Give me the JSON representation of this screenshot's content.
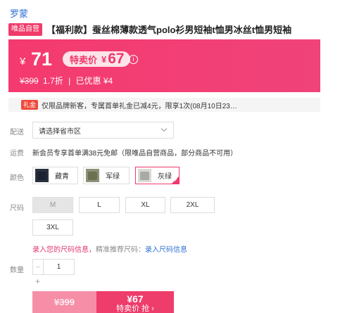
{
  "brand": "罗蒙",
  "product": {
    "vip_tag": "唯品自营",
    "title": "【福利款】蚕丝棉薄款透气polo衫男短袖t恤男冰丝t恤男短袖"
  },
  "price": {
    "yen": "¥",
    "current": "71",
    "special_label": "特卖价",
    "special_yen": "¥",
    "special_value": "67",
    "info_icon": "i",
    "original": "¥399",
    "discount": "1.7折",
    "separator": "|",
    "saved": "已优惠 ¥4"
  },
  "coupon": {
    "badge": "礼金",
    "text": "仅限品牌新客，专属首单礼金已减4元，限享1次(08月10日23…"
  },
  "delivery": {
    "label": "配送",
    "select_placeholder": "请选择省市区"
  },
  "freight": {
    "label": "运费",
    "text": "新会员专享首单满38元免邮（限唯品自营商品，部分商品不可用）"
  },
  "colors": {
    "label": "颜色",
    "options": [
      {
        "name": "藏青",
        "icon": "navy-shirt-thumbnail",
        "selected": false
      },
      {
        "name": "军绿",
        "icon": "army-green-shirt-thumbnail",
        "selected": false
      },
      {
        "name": "灰绿",
        "icon": "gray-green-shirt-thumbnail",
        "selected": true
      }
    ],
    "check": "✓"
  },
  "sizes": {
    "label": "尺码",
    "options": [
      {
        "name": "M",
        "disabled": true
      },
      {
        "name": "L",
        "disabled": false
      },
      {
        "name": "XL",
        "disabled": false
      },
      {
        "name": "2XL",
        "disabled": false
      },
      {
        "name": "3XL",
        "disabled": false
      }
    ],
    "hint_pink": "录入您的尺码信息，",
    "hint_gray": "精准推荐尺码：",
    "hint_link": "录入尺码信息"
  },
  "quantity": {
    "label": "数量",
    "minus": "−",
    "value": "1",
    "plus": "+"
  },
  "buy": {
    "original": "¥399",
    "price": "¥67",
    "label": "特卖价 抢 ›"
  },
  "colors_theme": {
    "accent": "#f0386a",
    "link": "#2f6fd6"
  }
}
